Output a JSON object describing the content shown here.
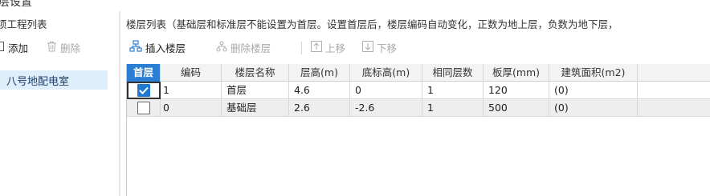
{
  "window": {
    "title": "层设置"
  },
  "left": {
    "header": "项工程列表",
    "add_label": "添加",
    "delete_label": "删除",
    "items": [
      {
        "label": "八号地配电室"
      }
    ]
  },
  "right": {
    "info": "楼层列表（基础层和标准层不能设置为首层。设置首层后，楼层编码自动变化，正数为地上层，负数为地下层，",
    "toolbar": {
      "insert_label": "插入楼层",
      "delete_label": "删除楼层",
      "up_label": "上移",
      "down_label": "下移"
    },
    "columns": [
      "首层",
      "编码",
      "楼层名称",
      "层高(m)",
      "底标高(m)",
      "相同层数",
      "板厚(mm)",
      "建筑面积(m2)"
    ],
    "rows": [
      {
        "first": true,
        "code": "1",
        "name": "首层",
        "height": "4.6",
        "bottom": "0",
        "same": "1",
        "thick": "120",
        "area": "(0)"
      },
      {
        "first": false,
        "code": "0",
        "name": "基础层",
        "height": "2.6",
        "bottom": "-2.6",
        "same": "1",
        "thick": "500",
        "area": "(0)"
      }
    ]
  },
  "colors": {
    "accent": "#2a7fd4",
    "checkbox_on": "#1f78d1",
    "selected_item_bg": "#dfeefb"
  }
}
